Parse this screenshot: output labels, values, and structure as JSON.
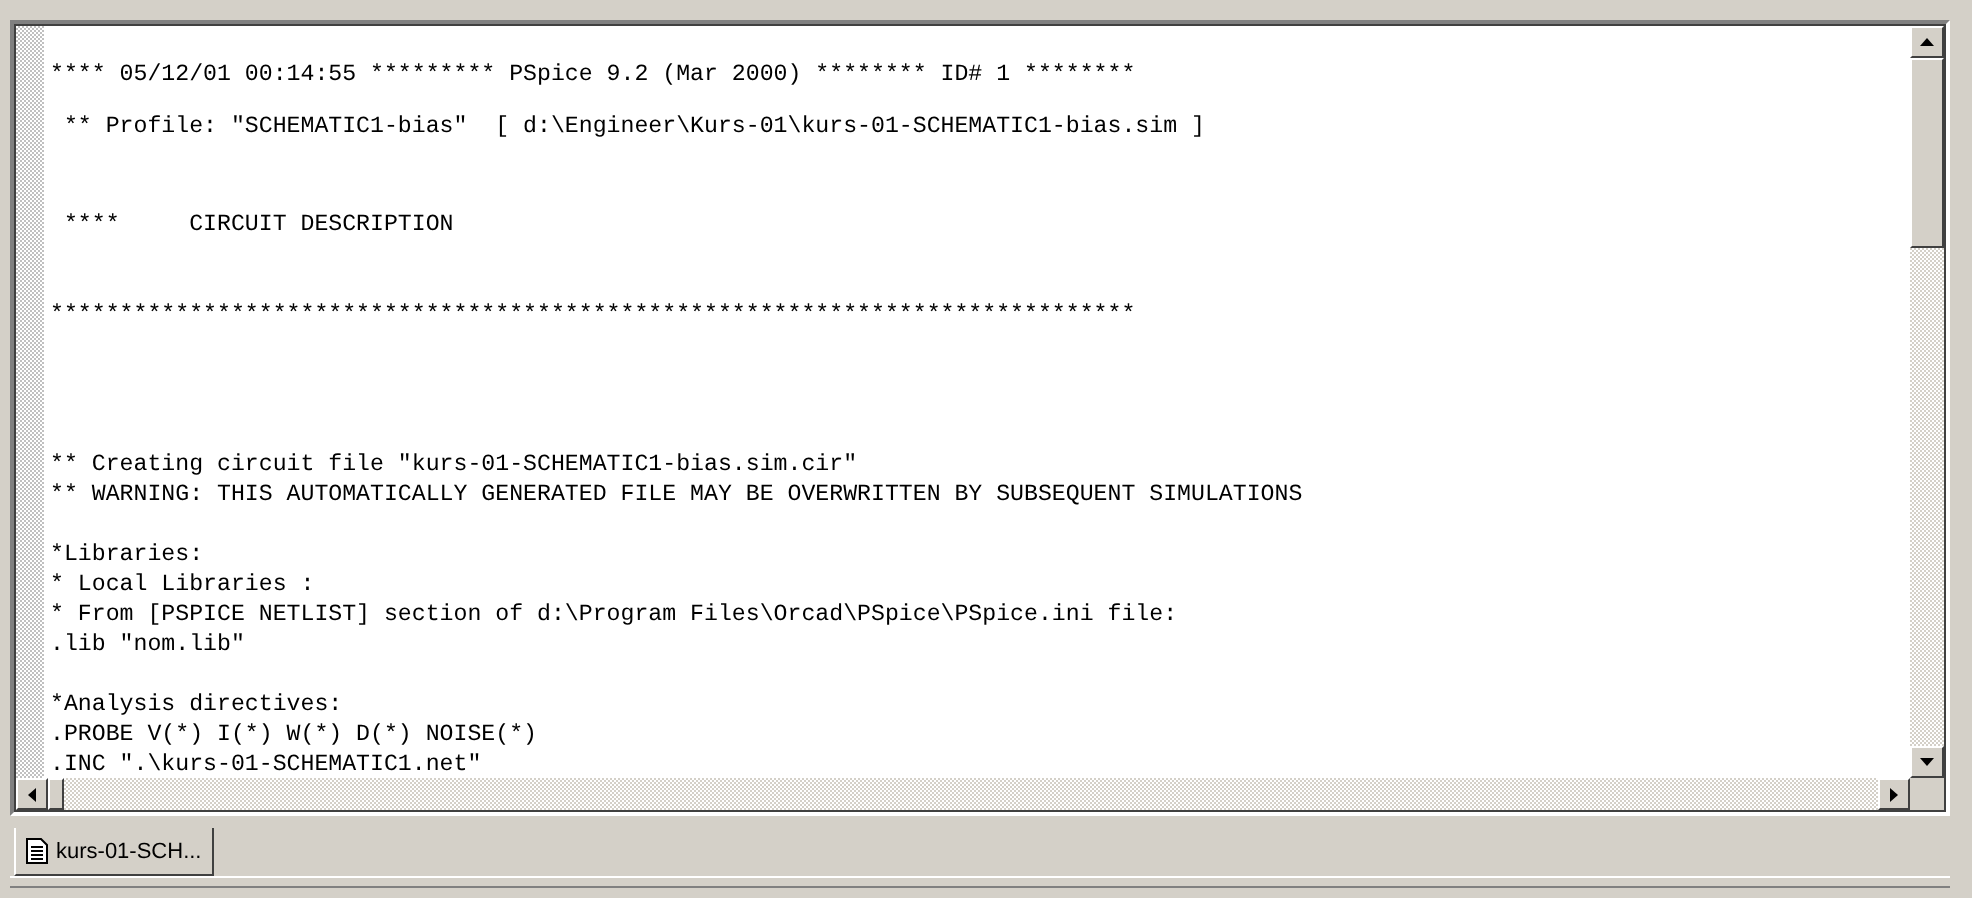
{
  "output_blocks": [
    {
      "lines": [
        "**** 05/12/01 00:14:55 ********* PSpice 9.2 (Mar 2000) ******** ID# 1 ********"
      ]
    },
    {
      "lines": [
        " ** Profile: \"SCHEMATIC1-bias\"  [ d:\\Engineer\\Kurs-01\\kurs-01-SCHEMATIC1-bias.sim ]"
      ]
    },
    {
      "lines": [
        " ****     CIRCUIT DESCRIPTION"
      ]
    },
    {
      "lines": [
        "******************************************************************************"
      ]
    },
    {
      "lines": [
        "** Creating circuit file \"kurs-01-SCHEMATIC1-bias.sim.cir\"",
        "** WARNING: THIS AUTOMATICALLY GENERATED FILE MAY BE OVERWRITTEN BY SUBSEQUENT SIMULATIONS"
      ]
    },
    {
      "lines": [
        "*Libraries:",
        "* Local Libraries :",
        "* From [PSPICE NETLIST] section of d:\\Program Files\\Orcad\\PSpice\\PSpice.ini file:",
        ".lib \"nom.lib\""
      ]
    },
    {
      "lines": [
        "*Analysis directives:",
        ".PROBE V(*) I(*) W(*) D(*) NOISE(*)",
        ".INC \".\\kurs-01-SCHEMATIC1.net\""
      ]
    }
  ],
  "tabs": [
    {
      "label": "kurs-01-SCH...",
      "selected": true
    }
  ]
}
